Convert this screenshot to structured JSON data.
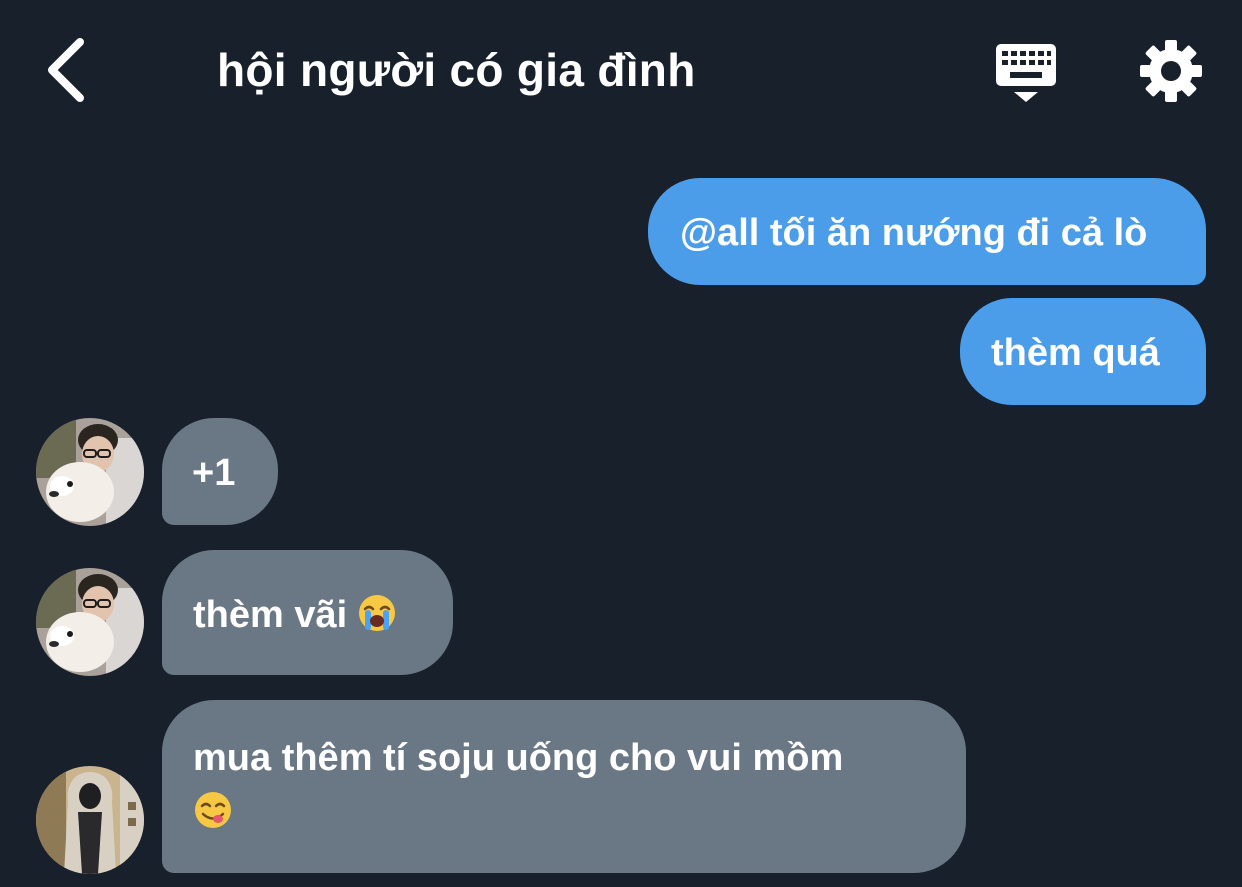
{
  "header": {
    "title": "hội người có gia đình",
    "back_icon": "chevron-left-icon",
    "keyboard_icon": "keyboard-icon",
    "settings_icon": "gear-icon"
  },
  "colors": {
    "background": "#18202b",
    "outgoing_bubble": "#4b9de9",
    "incoming_bubble": "#6a7785",
    "text": "#ffffff"
  },
  "messages": [
    {
      "direction": "outgoing",
      "text": "@all tối ăn nướng đi cả lò"
    },
    {
      "direction": "outgoing",
      "text": "thèm quá"
    },
    {
      "direction": "incoming",
      "text": "+1",
      "avatar": "avatar-photo-boy-with-dog"
    },
    {
      "direction": "incoming",
      "text": "thèm vãi",
      "emoji": "loudly-crying-face-icon"
    },
    {
      "direction": "incoming",
      "text": "mua thêm tí soju uống cho vui mồm",
      "emoji": "face-savoring-food-icon",
      "avatar": "avatar-photo-hooded-person"
    }
  ]
}
